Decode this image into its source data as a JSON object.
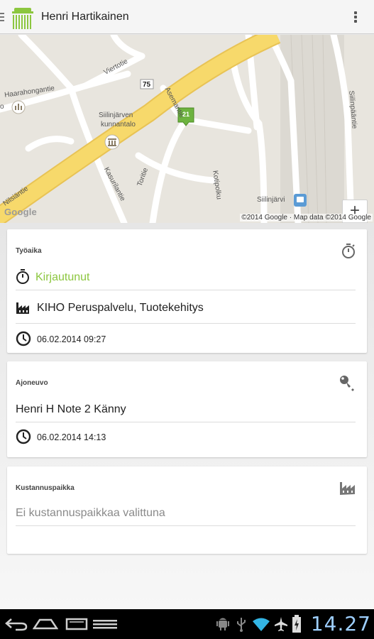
{
  "header": {
    "title": "Henri Hartikainen",
    "logo_icon": "building-logo-icon",
    "overflow_icon": "overflow-menu-icon"
  },
  "map": {
    "labels": {
      "haarahongantie": "Haarahongantie",
      "viertotie": "Viertotie",
      "road_number": "75",
      "asemantie": "Asemantie",
      "kunnantalo_1": "Siilinjärven",
      "kunnantalo_2": "kunnantalo",
      "marker": "21",
      "kasurilantie": "Kasurilantie",
      "toritie": "Toritie",
      "kotipolku": "Kotipolku",
      "siilinjarvi": "Siilinjärvi",
      "nilsiantie": "Nilsiäntie",
      "siilinpaantie": "Siilinpääntie",
      "partial_left": "o"
    },
    "zoom_in": "+",
    "zoom_out": "−",
    "attribution": "©2014 Google · Map data ©2014 Google",
    "google_logo": "Google"
  },
  "cards": {
    "tyoaika": {
      "header": "Työaika",
      "status": "Kirjautunut",
      "workplace": "KIHO Peruspalvelu, Tuotekehitys",
      "time": "06.02.2014 09:27"
    },
    "ajoneuvo": {
      "header": "Ajoneuvo",
      "vehicle": "Henri H Note 2 Känny",
      "time": "06.02.2014 14:13"
    },
    "kustannuspaikka": {
      "header": "Kustannuspaikka",
      "value": "Ei kustannuspaikkaa valittuna"
    }
  },
  "statusbar": {
    "clock": "14.27"
  },
  "colors": {
    "accent_green": "#8cc63f",
    "road_yellow": "#f7d96b",
    "clock_blue": "#9ecfff"
  }
}
